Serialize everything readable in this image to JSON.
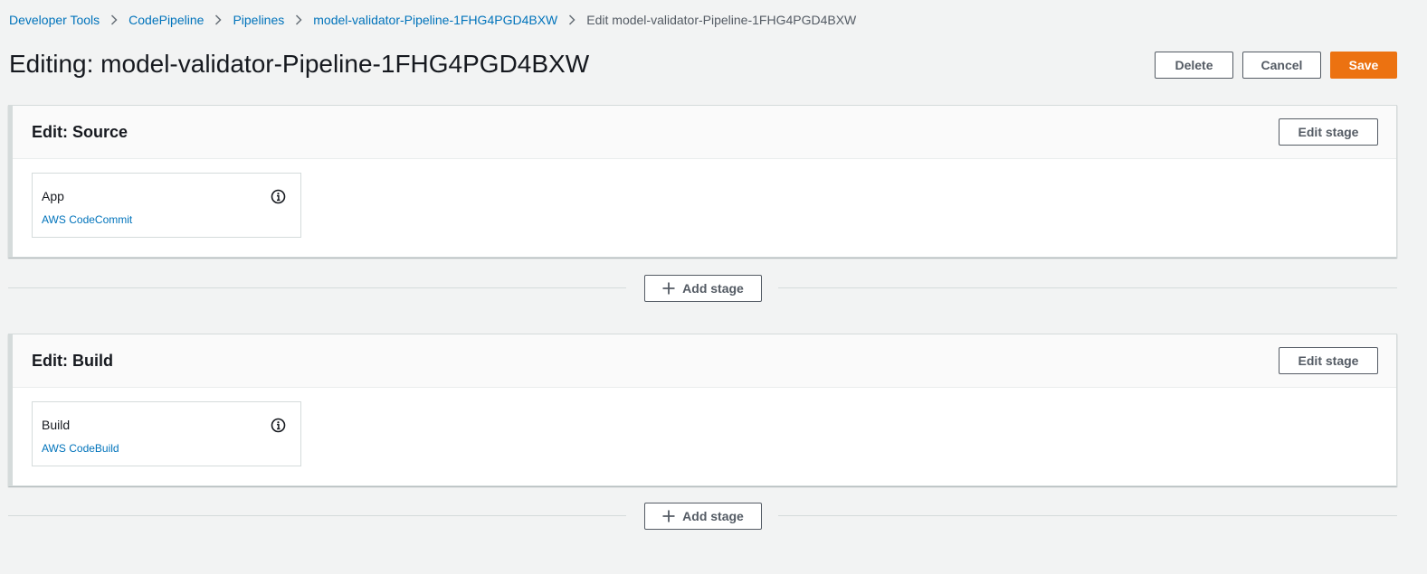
{
  "breadcrumbs": [
    {
      "label": "Developer Tools"
    },
    {
      "label": "CodePipeline"
    },
    {
      "label": "Pipelines"
    },
    {
      "label": "model-validator-Pipeline-1FHG4PGD4BXW"
    },
    {
      "label": "Edit model-validator-Pipeline-1FHG4PGD4BXW"
    }
  ],
  "header": {
    "title": "Editing: model-validator-Pipeline-1FHG4PGD4BXW",
    "delete_label": "Delete",
    "cancel_label": "Cancel",
    "save_label": "Save"
  },
  "stages": [
    {
      "title": "Edit: Source",
      "edit_label": "Edit stage",
      "action": {
        "name": "App",
        "provider": "AWS CodeCommit"
      }
    },
    {
      "title": "Edit: Build",
      "edit_label": "Edit stage",
      "action": {
        "name": "Build",
        "provider": "AWS CodeBuild"
      }
    }
  ],
  "add_stage_label": "Add stage",
  "icons": {
    "breadcrumb_separator": "chevron-right-icon",
    "action_info": "info-icon",
    "add_stage": "plus-icon"
  },
  "colors": {
    "page_background": "#f2f3f3",
    "link": "#0073bb",
    "primary_button": "#ec7211",
    "text": "#16191f",
    "border": "#d5dbdb"
  }
}
